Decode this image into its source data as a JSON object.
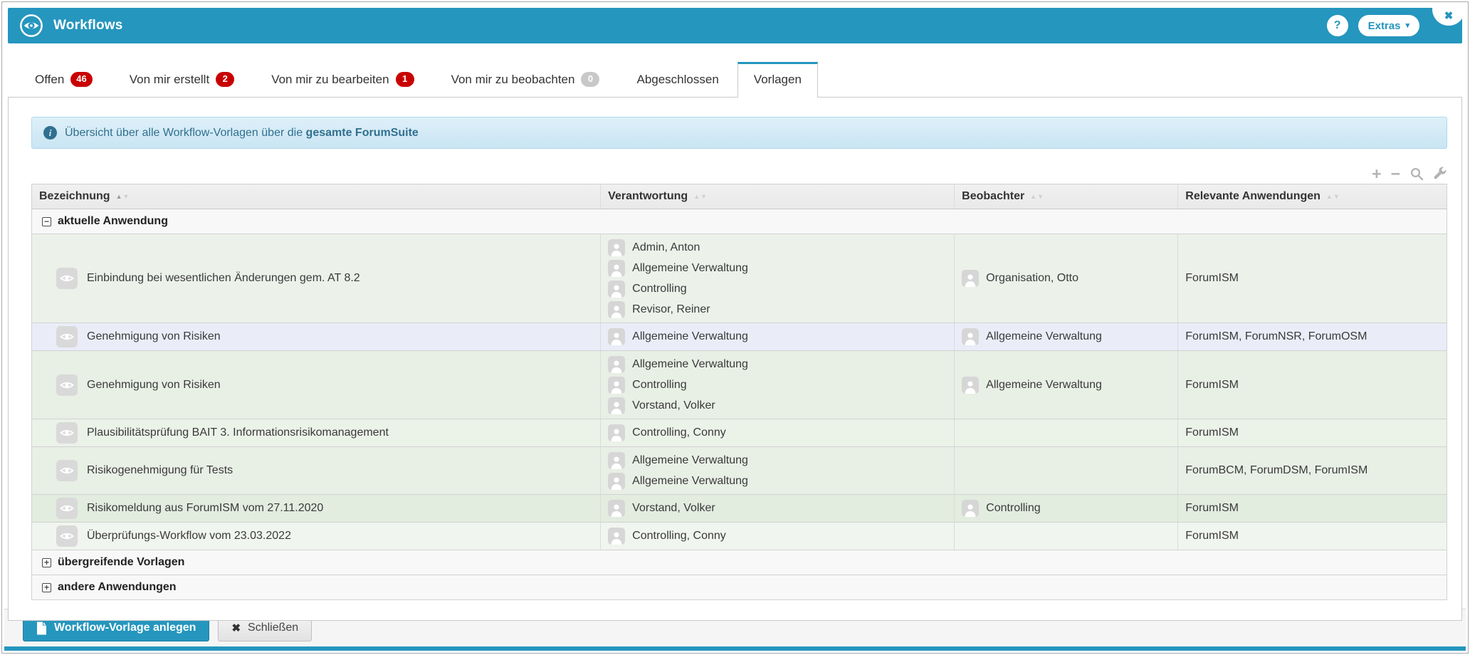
{
  "header": {
    "title": "Workflows",
    "help_label": "?",
    "extras_label": "Extras",
    "extras_caret": "▾",
    "close_glyph": "✖"
  },
  "tabs": [
    {
      "label": "Offen",
      "badge": "46",
      "badge_style": "red",
      "active": false
    },
    {
      "label": "Von mir erstellt",
      "badge": "2",
      "badge_style": "red",
      "active": false
    },
    {
      "label": "Von mir zu bearbeiten",
      "badge": "1",
      "badge_style": "red",
      "active": false
    },
    {
      "label": "Von mir zu beobachten",
      "badge": "0",
      "badge_style": "gray",
      "active": false
    },
    {
      "label": "Abgeschlossen",
      "badge": null,
      "active": false
    },
    {
      "label": "Vorlagen",
      "badge": null,
      "active": true
    }
  ],
  "info_banner": {
    "icon": "info-icon",
    "icon_glyph": "i",
    "text_prefix": "Übersicht über alle Workflow-Vorlagen über die ",
    "text_bold": "gesamte ForumSuite"
  },
  "toolbar": {
    "plus_glyph": "+",
    "minus_glyph": "−",
    "icons": [
      "plus-icon",
      "minus-icon",
      "search-icon",
      "wrench-icon"
    ]
  },
  "table": {
    "sort_asc_glyph": "▲",
    "sort_desc_glyph": "▼",
    "columns": [
      {
        "label": "Bezeichnung",
        "sort": "asc"
      },
      {
        "label": "Verantwortung",
        "sort": null
      },
      {
        "label": "Beobachter",
        "sort": null
      },
      {
        "label": "Relevante Anwendungen",
        "sort": null
      }
    ],
    "groups": [
      {
        "label": "aktuelle Anwendung",
        "expanded": true,
        "toggle_glyph": "−",
        "rows": [
          {
            "bezeichnung": "Einbindung bei wesentlichen Änderungen gem. AT 8.2",
            "verantwortung": [
              "Admin, Anton",
              "Allgemeine Verwaltung",
              "Controlling",
              "Revisor, Reiner"
            ],
            "beobachter": [
              "Organisation, Otto"
            ],
            "relevante_anwendungen": "ForumISM",
            "row_bg": "#ecf1ea"
          },
          {
            "bezeichnung": "Genehmigung von Risiken",
            "verantwortung": [
              "Allgemeine Verwaltung"
            ],
            "beobachter": [
              "Allgemeine Verwaltung"
            ],
            "relevante_anwendungen": "ForumISM, ForumNSR, ForumOSM",
            "row_bg": "#eaedf8"
          },
          {
            "bezeichnung": "Genehmigung von Risiken",
            "verantwortung": [
              "Allgemeine Verwaltung",
              "Controlling",
              "Vorstand, Volker"
            ],
            "beobachter": [
              "Allgemeine Verwaltung"
            ],
            "relevante_anwendungen": "ForumISM",
            "row_bg": "#e8efe5"
          },
          {
            "bezeichnung": "Plausibilitätsprüfung BAIT 3. Informationsrisikomanagement",
            "verantwortung": [
              "Controlling, Conny"
            ],
            "beobachter": [],
            "relevante_anwendungen": "ForumISM",
            "row_bg": "#ebf2e8"
          },
          {
            "bezeichnung": "Risikogenehmigung für Tests",
            "verantwortung": [
              "Allgemeine Verwaltung",
              "Allgemeine Verwaltung"
            ],
            "beobachter": [],
            "relevante_anwendungen": "ForumBCM, ForumDSM, ForumISM",
            "row_bg": "#e8efe5"
          },
          {
            "bezeichnung": "Risikomeldung aus ForumISM vom 27.11.2020",
            "verantwortung": [
              "Vorstand, Volker"
            ],
            "beobachter": [
              "Controlling"
            ],
            "relevante_anwendungen": "ForumISM",
            "row_bg": "#e2ecdf"
          },
          {
            "bezeichnung": "Überprüfungs-Workflow vom 23.03.2022",
            "verantwortung": [
              "Controlling, Conny"
            ],
            "beobachter": [],
            "relevante_anwendungen": "ForumISM",
            "row_bg": "#f1f5ef"
          }
        ]
      },
      {
        "label": "übergreifende Vorlagen",
        "expanded": false,
        "toggle_glyph": "+",
        "rows": []
      },
      {
        "label": "andere Anwendungen",
        "expanded": false,
        "toggle_glyph": "+",
        "rows": []
      }
    ]
  },
  "footer": {
    "create_label": "Workflow-Vorlage anlegen",
    "close_label": "Schließen",
    "close_glyph": "✖"
  },
  "colors": {
    "header_blue": "#2596be",
    "badge_red": "#c90000",
    "badge_gray": "#c8c8c8",
    "banner_text": "#31708f"
  }
}
